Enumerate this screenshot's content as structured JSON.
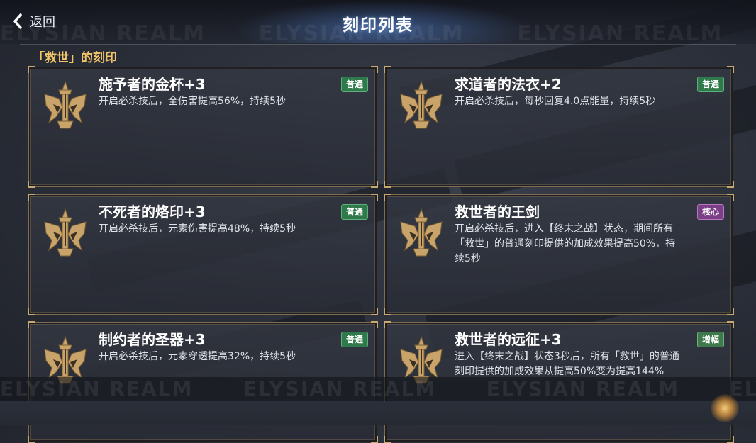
{
  "header": {
    "back_label": "返回",
    "title": "刻印列表"
  },
  "watermark": "ELYSIAN REALM",
  "section_title": "「救世」的刻印",
  "cards": [
    {
      "name": "施予者的金杯+3",
      "badge": "普通",
      "badge_type": "normal",
      "lines": [
        "开启必杀技后，全伤害提高56%，持续5秒"
      ]
    },
    {
      "name": "求道者的法衣+2",
      "badge": "普通",
      "badge_type": "normal",
      "lines": [
        "开启必杀技后，每秒回复4.0点能量，持续5秒"
      ]
    },
    {
      "name": "不死者的烙印+3",
      "badge": "普通",
      "badge_type": "normal",
      "lines": [
        "开启必杀技后，元素伤害提高48%，持续5秒"
      ]
    },
    {
      "name": "救世者的王剑",
      "badge": "核心",
      "badge_type": "core",
      "lines": [
        "开启必杀技后，进入【终末之战】状态，期间所有",
        "「救世」的普通刻印提供的加成效果提高50%，持",
        "续5秒"
      ]
    },
    {
      "name": "制约者的圣器+3",
      "badge": "普通",
      "badge_type": "normal",
      "lines": [
        "开启必杀技后，元素穿透提高32%，持续5秒"
      ]
    },
    {
      "name": "救世者的远征+3",
      "badge": "增幅",
      "badge_type": "amp",
      "lines": [
        "进入【终末之战】状态3秒后，所有「救世」的普通",
        "刻印提供的加成效果从提高50%变为提高144%"
      ]
    }
  ],
  "colors": {
    "section_gold": "#f2c46b",
    "badge_normal": "#2f7a4a",
    "badge_core": "#7a3f86",
    "badge_amp": "#3f7a4c",
    "emblem_gold": "#c9a46a"
  },
  "icons": {
    "back": "chevron-left-icon",
    "emblem": "sword-crest-icon"
  }
}
